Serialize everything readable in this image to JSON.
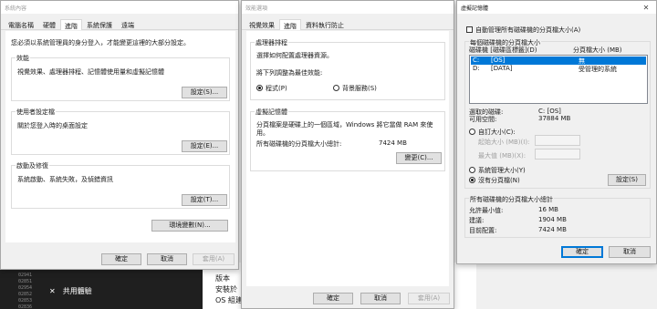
{
  "background": {
    "terminal_lines": [
      "02931",
      "02941",
      "02851",
      "02954",
      "02852",
      "02853",
      "02836",
      "02851",
      "02931"
    ],
    "nav_item": "共用體驗",
    "side_lines": [
      "版本",
      "安裝於",
      "OS 組建"
    ]
  },
  "sys_props": {
    "title": "系統內容",
    "tabs": [
      "電腦名稱",
      "硬體",
      "進階",
      "系統保護",
      "遠端"
    ],
    "intro": "您必須以系統管理員的身分登入，才能變更這裡的大部分設定。",
    "perf": {
      "title": "效能",
      "desc": "視覺效果、處理器排程、記憶體使用量和虛擬記憶體",
      "button": "設定(S)..."
    },
    "profile": {
      "title": "使用者設定檔",
      "desc": "關於您登入時的桌面設定",
      "button": "設定(E)..."
    },
    "startup": {
      "title": "啟動及修復",
      "desc": "系統啟動、系統失敗，及偵錯資訊",
      "button": "設定(T)..."
    },
    "env_button": "環境變數(N)...",
    "ok": "確定",
    "cancel": "取消",
    "apply": "套用(A)"
  },
  "perf_opts": {
    "title": "效能選項",
    "tabs": [
      "視覺效果",
      "進階",
      "資料執行防止"
    ],
    "sched": {
      "title": "處理器排程",
      "desc": "選擇如何配置處理器資源。",
      "prompt": "將下列調整為最佳效能:",
      "opt_programs": "程式(P)",
      "opt_bg": "背景服務(S)"
    },
    "vm": {
      "title": "虛擬記憶體",
      "desc1": "分頁檔案是硬碟上的一個區域，Windows 將它當做 RAM 來使",
      "desc2": "用。",
      "total_label": "所有磁碟機的分頁檔大小總計:",
      "total_value": "7424 MB",
      "button": "變更(C)..."
    },
    "ok": "確定",
    "cancel": "取消",
    "apply": "套用(A)"
  },
  "vmem": {
    "title": "虛擬記憶體",
    "auto_manage": "自動管理所有磁碟機的分頁檔大小(A)",
    "drive_group_title": "每個磁碟機的分頁檔大小",
    "col_drive": "磁碟機 [磁碟區標籤](D)",
    "col_size": "分頁檔大小 (MB)",
    "drives": [
      {
        "drive": "C:",
        "label": "[OS]",
        "size": "無"
      },
      {
        "drive": "D:",
        "label": "[DATA]",
        "size": "受管理的系統"
      }
    ],
    "selected_drive_label": "選取的磁碟:",
    "selected_drive_value": "C: [OS]",
    "free_space_label": "可用空間:",
    "free_space_value": "37884 MB",
    "custom_size": "自訂大小(C):",
    "initial_size": "起始大小 (MB)(I):",
    "max_size": "最大值 (MB)(X):",
    "system_managed": "系統管理大小(Y)",
    "no_paging": "沒有分頁檔(N)",
    "set_button": "設定(S)",
    "total_group_title": "所有磁碟機的分頁檔大小總計",
    "min_allowed_label": "允許最小值:",
    "min_allowed_value": "16 MB",
    "recommended_label": "建議:",
    "recommended_value": "1904 MB",
    "current_label": "目前配置:",
    "current_value": "7424 MB",
    "ok": "確定",
    "cancel": "取消"
  }
}
